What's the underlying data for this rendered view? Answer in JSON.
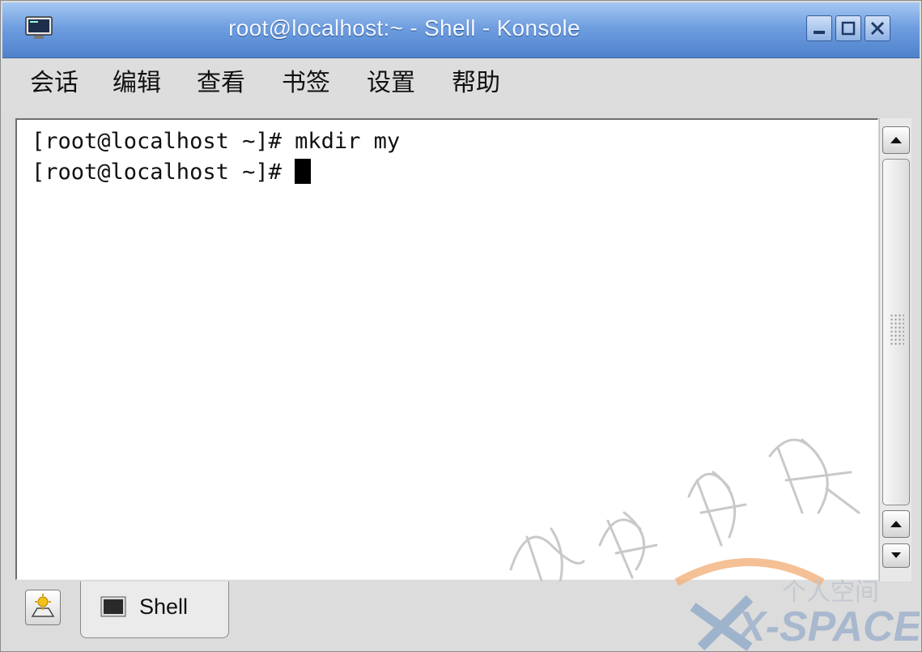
{
  "window": {
    "title": "root@localhost:~ - Shell - Konsole",
    "icon": "konsole-icon",
    "controls": [
      "minimize-icon",
      "maximize-icon",
      "close-icon"
    ]
  },
  "menubar": {
    "items": [
      "会话",
      "编辑",
      "查看",
      "书签",
      "设置",
      "帮助"
    ]
  },
  "terminal": {
    "lines": [
      {
        "prompt": "[root@localhost ~]# ",
        "command": "mkdir my"
      },
      {
        "prompt": "[root@localhost ~]# ",
        "command": ""
      }
    ],
    "background": "#ffffff",
    "foreground": "#111111"
  },
  "tabs": {
    "items": [
      {
        "label": "Shell",
        "icon": "terminal-icon"
      }
    ],
    "new_tab_icon": "new-session-icon"
  },
  "watermark": {
    "calligraphy": "骏博科技",
    "logo_cn": "个人空间",
    "logo_en": "X-SPACE"
  },
  "colors": {
    "titlebar": "#6f9ee0",
    "accent": "#4f82cc"
  }
}
